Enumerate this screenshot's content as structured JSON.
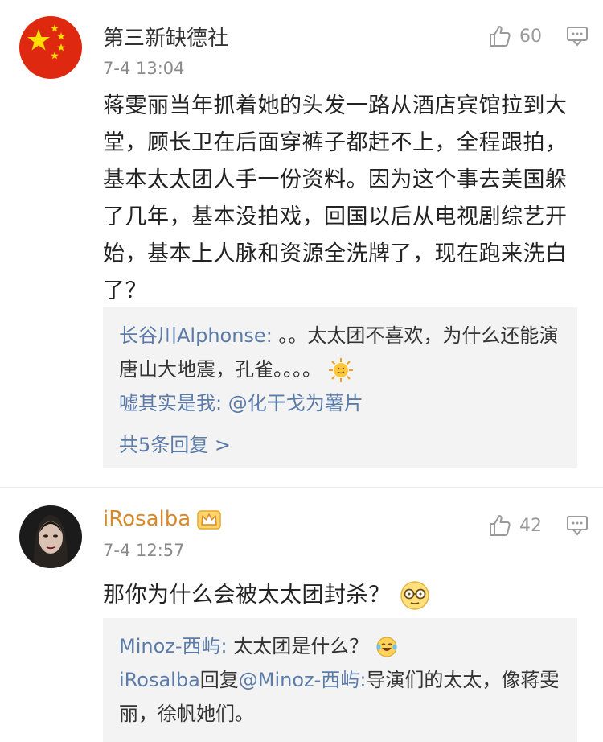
{
  "comments": [
    {
      "username": "第三新缺德社",
      "time": "7-4 13:04",
      "likes": "60",
      "text": "蒋雯丽当年抓着她的头发一路从酒店宾馆拉到大堂，顾长卫在后面穿裤子都赶不上，全程跟拍，基本太太团人手一份资料。因为这个事去美国躲了几年，基本没拍戏，回国以后从电视剧综艺开始，基本上人脉和资源全洗牌了，现在跑来洗白了？",
      "replies": [
        {
          "name": "长谷川Alphonse",
          "sep": ":",
          "text": " 。。太太团不喜欢，为什么还能演唐山大地震，孔雀。。。。"
        },
        {
          "name": "嘘其实是我",
          "sep": ":",
          "text": " @化干戈为薯片"
        }
      ],
      "more_replies": "共5条回复 >"
    },
    {
      "username": "iRosalba",
      "time": "7-4 12:57",
      "likes": "42",
      "text": "那你为什么会被太太团封杀？",
      "replies": [
        {
          "name": "Minoz-西屿",
          "sep": ":",
          "text": " 太太团是什么？"
        },
        {
          "name": "iRosalba",
          "mid": "回复",
          "mention": "@Minoz-西屿",
          "sep": ":",
          "text": "导演们的太太，像蒋雯丽，徐帆她们。"
        }
      ]
    }
  ],
  "colors": {
    "link": "#5b7ba8",
    "vip": "#d88a2a",
    "meta": "#8a8a8a",
    "reply_bg": "#f3f3f3"
  }
}
